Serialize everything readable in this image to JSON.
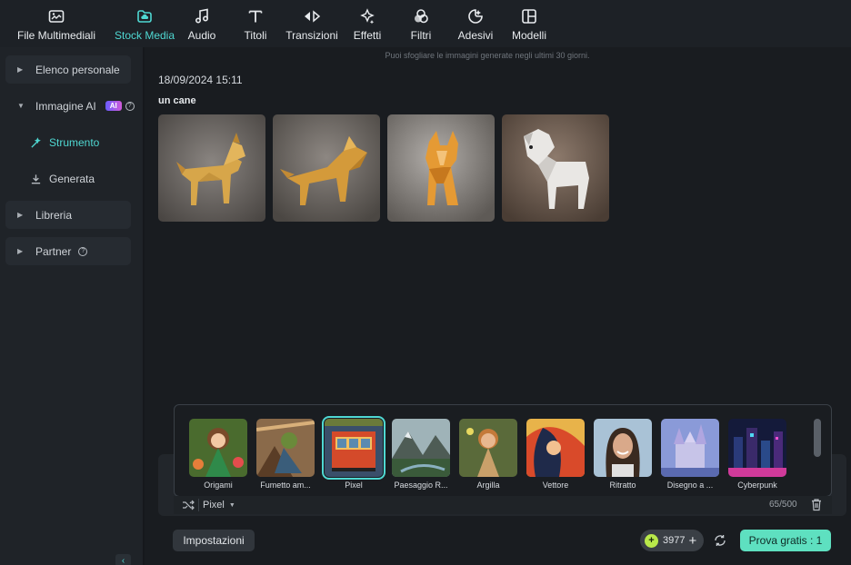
{
  "toolbar": {
    "items": [
      {
        "label": "File Multimediali",
        "icon": "media-icon"
      },
      {
        "label": "Stock Media",
        "icon": "cloud-folder-icon",
        "active": true
      },
      {
        "label": "Audio",
        "icon": "music-note-icon"
      },
      {
        "label": "Titoli",
        "icon": "text-icon"
      },
      {
        "label": "Transizioni",
        "icon": "transition-icon"
      },
      {
        "label": "Effetti",
        "icon": "sparkle-icon"
      },
      {
        "label": "Filtri",
        "icon": "filter-icon"
      },
      {
        "label": "Adesivi",
        "icon": "sticker-icon"
      },
      {
        "label": "Modelli",
        "icon": "template-icon"
      }
    ]
  },
  "sidebar": {
    "elenco_personale": "Elenco personale",
    "immagine_ai": "Immagine AI",
    "ai_badge": "AI",
    "strumento": "Strumento",
    "generata": "Generata",
    "libreria": "Libreria",
    "partner": "Partner"
  },
  "main": {
    "notice": "Puoi sfogliare le immagini generate negli ultimi 30 giorni.",
    "timestamp": "18/09/2024 15:11",
    "prompt": "un cane",
    "images": [
      "origami-dog-1",
      "origami-dog-2",
      "origami-dog-3",
      "origami-dog-4"
    ]
  },
  "styles": {
    "items": [
      {
        "label": "Origami"
      },
      {
        "label": "Fumetto am..."
      },
      {
        "label": "Pixel",
        "selected": true
      },
      {
        "label": "Paesaggio R..."
      },
      {
        "label": "Argilla"
      },
      {
        "label": "Vettore"
      },
      {
        "label": "Ritratto"
      },
      {
        "label": "Disegno a ..."
      },
      {
        "label": "Cyberpunk"
      }
    ],
    "current": "Pixel",
    "counter": "65/500"
  },
  "footer": {
    "settings": "Impostazioni",
    "credits": "3977",
    "try_label": "Prova gratis : 1"
  },
  "colors": {
    "accent": "#4fd8d2",
    "try_button": "#5ee0c0"
  }
}
